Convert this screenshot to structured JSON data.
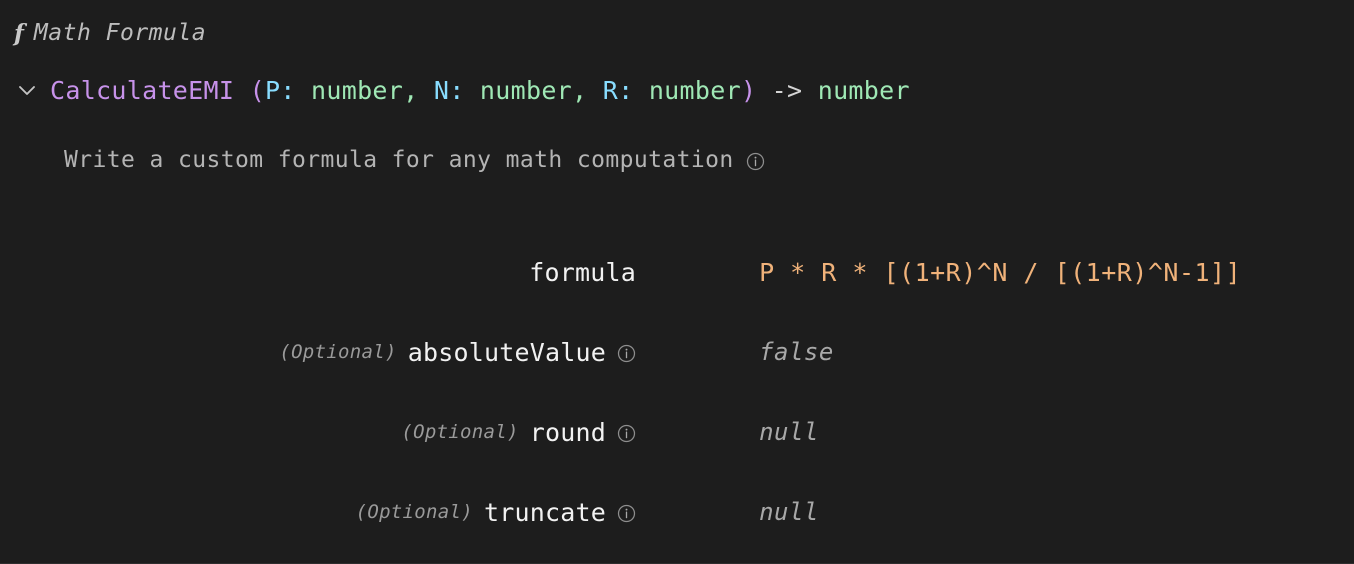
{
  "colors": {
    "background": "#1d1d1d",
    "function_name": "#c792ea",
    "punctuation": "#c792ea",
    "param_name": "#89ddff",
    "type_name": "#9fe8b5",
    "value_string": "#f0b27a",
    "value_literal": "#a8a8a8",
    "label": "#f2f2f2",
    "muted": "#9a9a9a",
    "border": "#2e2e2e"
  },
  "header": {
    "function_glyph": "f",
    "title": "Math Formula"
  },
  "signature": {
    "collapse_icon": "chevron-down-icon",
    "expanded": true,
    "function_name": "CalculateEMI",
    "open_paren": "(",
    "close_paren": ")",
    "comma": ",",
    "colon": ":",
    "arrow": "->",
    "parameters": [
      {
        "name": "P",
        "type": "number"
      },
      {
        "name": "N",
        "type": "number"
      },
      {
        "name": "R",
        "type": "number"
      }
    ],
    "return_type": "number"
  },
  "description": {
    "text": "Write a custom formula for any math computation",
    "info_icon": "info-icon"
  },
  "parameters": [
    {
      "optional_label": "",
      "is_optional": false,
      "name": "formula",
      "has_info_icon": false,
      "value": "P * R * [(1+R)^N / [(1+R)^N-1]]",
      "value_kind": "expression"
    },
    {
      "optional_label": "(Optional)",
      "is_optional": true,
      "name": "absoluteValue",
      "has_info_icon": true,
      "value": "false",
      "value_kind": "literal"
    },
    {
      "optional_label": "(Optional)",
      "is_optional": true,
      "name": "round",
      "has_info_icon": true,
      "value": "null",
      "value_kind": "literal"
    },
    {
      "optional_label": "(Optional)",
      "is_optional": true,
      "name": "truncate",
      "has_info_icon": true,
      "value": "null",
      "value_kind": "literal"
    }
  ]
}
